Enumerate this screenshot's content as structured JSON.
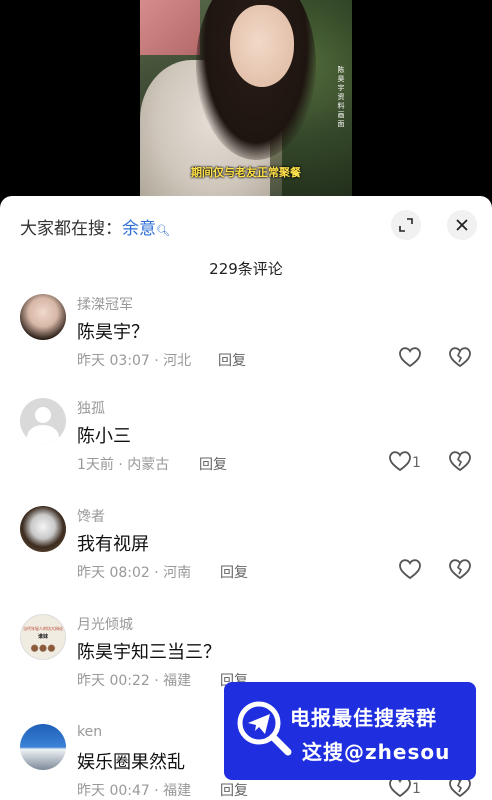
{
  "video": {
    "vertical_text": "陈昊宇资料画面",
    "caption": "期间仅与老友正常聚餐"
  },
  "search": {
    "prefix": "大家都在搜：",
    "keyword": "余意"
  },
  "comment_count": "229条评论",
  "comments": [
    {
      "username": "揉滐冠军",
      "text": "陈昊宇？",
      "meta": "昨天 03:07 · 河北",
      "reply": "回复",
      "likes": ""
    },
    {
      "username": "独孤",
      "text": "陈小三",
      "meta": "1天前 · 内蒙古",
      "reply": "回复",
      "likes": "1"
    },
    {
      "username": "馋者",
      "text": "我有视屏",
      "meta": "昨天 08:02 · 河南",
      "reply": "回复",
      "likes": ""
    },
    {
      "username": "月光倾城",
      "text": "陈昊宇知三当三？",
      "meta": "昨天 00:22 · 福建",
      "reply": "回复",
      "likes": ""
    },
    {
      "username": "ken",
      "text": "娱乐圈果然乱",
      "meta": "昨天 00:47 · 福建",
      "reply": "回复",
      "likes": "1"
    }
  ],
  "avatar4": {
    "line1": "当代年轻人的坊大辩论",
    "line2": "谁妹"
  },
  "banner": {
    "line1": "电报最佳搜索群",
    "line2": "这搜@zhesou"
  },
  "colors": {
    "keyword": "#2f6fd6",
    "caption": "#ffe14a",
    "banner": "#1f2fe0"
  }
}
